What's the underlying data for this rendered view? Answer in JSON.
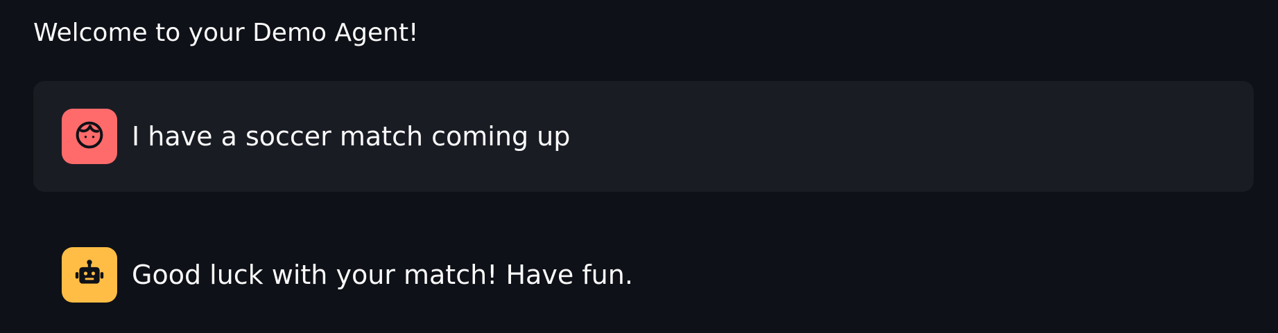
{
  "header": {
    "welcome_text": "Welcome to your Demo Agent!"
  },
  "messages": [
    {
      "role": "user",
      "icon": "face-icon",
      "avatar_color": "#ff6b6b",
      "text": "I have a soccer match coming up"
    },
    {
      "role": "assistant",
      "icon": "robot-icon",
      "avatar_color": "#ffbd45",
      "text": "Good luck with your match! Have fun."
    }
  ],
  "theme": {
    "background": "#0e1117",
    "user_message_background": "#1a1c24",
    "text_color": "#fafafa"
  }
}
